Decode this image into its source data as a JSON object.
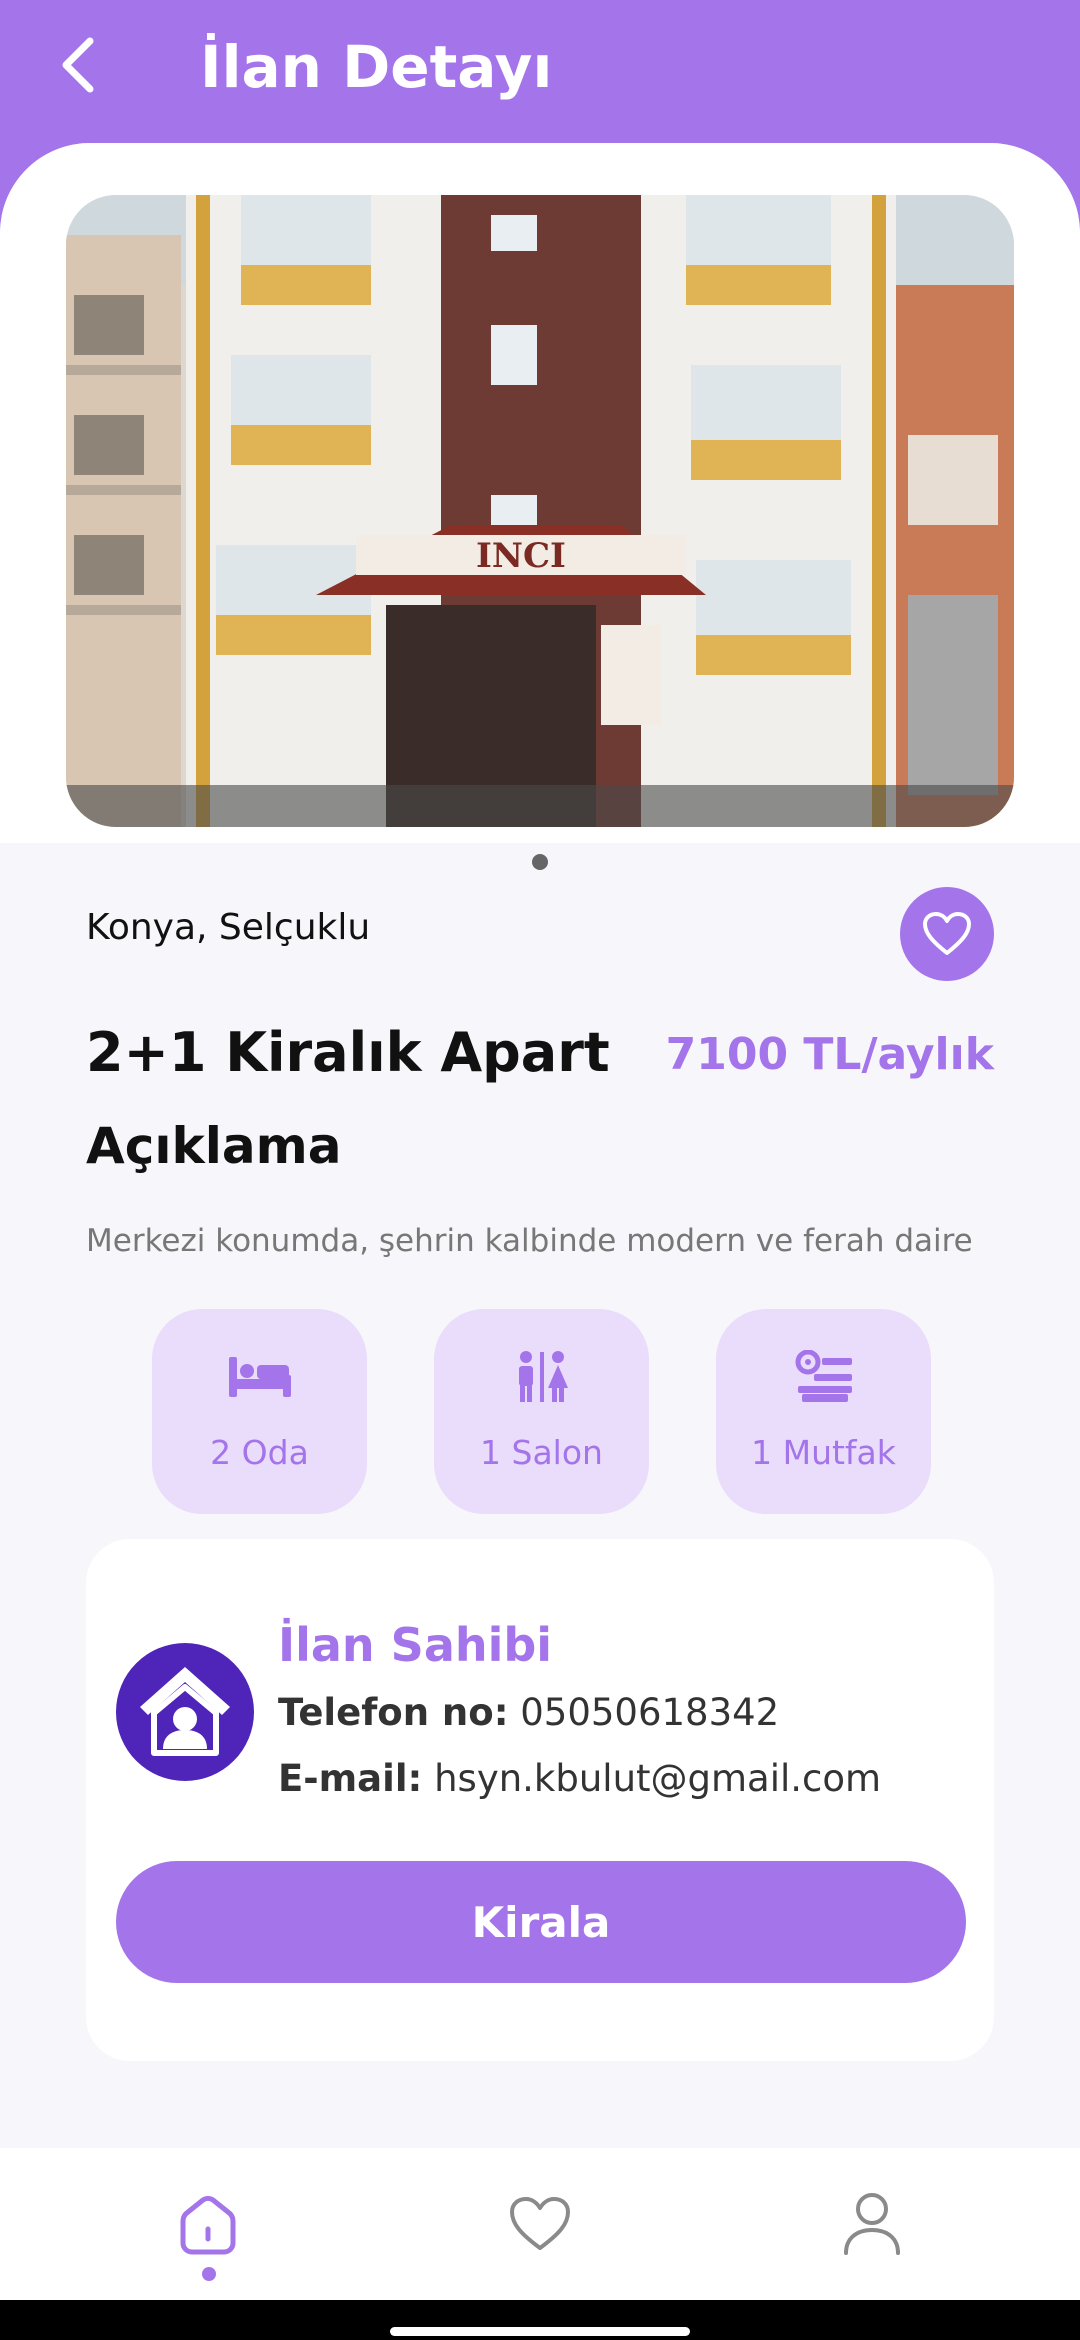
{
  "header": {
    "title": "İlan Detayı"
  },
  "carousel": {
    "page_count": 1,
    "active_index": 0
  },
  "listing": {
    "location": "Konya, Selçuklu",
    "title": "2+1 Kiralık Apart",
    "price": "7100 TL/aylık",
    "description_heading": "Açıklama",
    "description": "Merkezi konumda, şehrin kalbinde modern ve ferah daire",
    "features": [
      {
        "icon": "bed-icon",
        "label": "2 Oda"
      },
      {
        "icon": "people-icon",
        "label": "1 Salon"
      },
      {
        "icon": "kitchen-icon",
        "label": "1 Mutfak"
      }
    ]
  },
  "owner": {
    "title": "İlan Sahibi",
    "phone_label": "Telefon no:",
    "phone": "05050618342",
    "email_label": "E-mail:",
    "email": "hsyn.kbulut@gmail.com",
    "rent_button": "Kirala"
  },
  "nav": {
    "items": [
      "home-icon",
      "heart-icon",
      "user-icon"
    ],
    "active": "home-icon"
  },
  "colors": {
    "accent": "#a474ea",
    "accent_light": "#eadcfb",
    "avatar_bg": "#4f24b8"
  }
}
